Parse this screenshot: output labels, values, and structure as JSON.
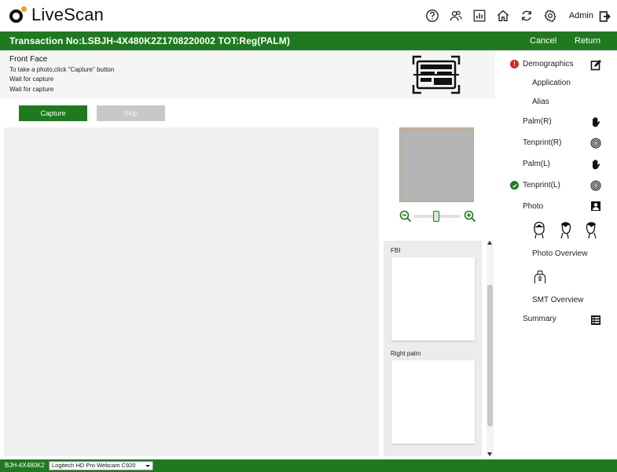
{
  "app": {
    "title": "LiveScan"
  },
  "header": {
    "user": "Admin"
  },
  "transaction": {
    "label": "Transaction No:LSBJH-4X480K2Z1708220002 TOT:Reg(PALM)",
    "cancel": "Cancel",
    "return": "Return"
  },
  "instructions": {
    "title": "Front Face",
    "line1": "To take a photo,click \"Capture\" button",
    "line2": "Wait for capture",
    "line3": "Wait for capture"
  },
  "actions": {
    "capture": "Capture",
    "skip": "Skip"
  },
  "panel": {
    "fbi_label": "FBI",
    "right_palm_label": "Right palm"
  },
  "nav": {
    "demographics": "Demographics",
    "application": "Application",
    "alias": "Alias",
    "palm_r": "Palm(R)",
    "tenprint_r": "Tenprint(R)",
    "palm_l": "Palm(L)",
    "tenprint_l": "Tenprint(L)",
    "photo": "Photo",
    "photo_overview": "Photo Overview",
    "smt_overview": "SMT Overview",
    "summary": "Summary"
  },
  "status": {
    "workstation": "BJH-4X480K2",
    "camera": "Logitech HD Pro Webcam C920"
  },
  "colors": {
    "brand_green": "#1f7a1f",
    "error_red": "#d62626",
    "thumb_border": "#f0a030",
    "logo_dot": "#f59a1a"
  }
}
